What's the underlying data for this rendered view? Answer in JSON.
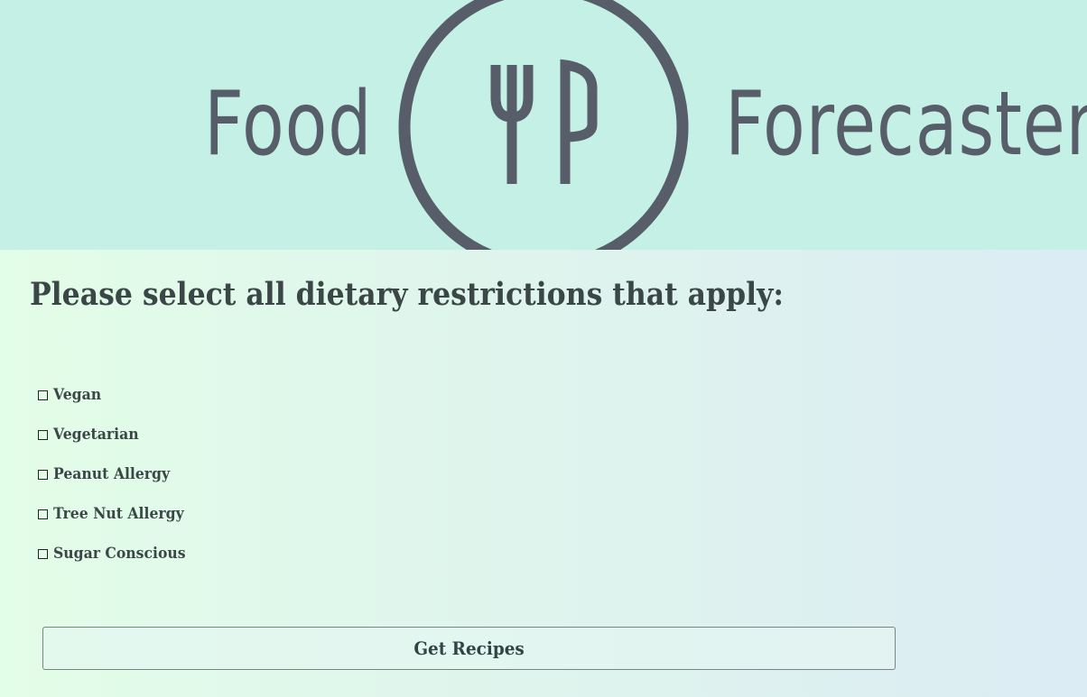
{
  "header": {
    "logo_left": "Food",
    "logo_right": "Forecaster",
    "logo_icon": "fork-knife-icon",
    "background": "#c4f0e5",
    "logo_color": "#575d69"
  },
  "form": {
    "title": "Please select all dietary restrictions that apply:",
    "options": [
      {
        "label": "Vegan",
        "checked": false
      },
      {
        "label": "Vegetarian",
        "checked": false
      },
      {
        "label": "Peanut Allergy",
        "checked": false
      },
      {
        "label": "Tree Nut Allergy",
        "checked": false
      },
      {
        "label": "Sugar Conscious",
        "checked": false
      }
    ],
    "submit_label": "Get Recipes"
  }
}
